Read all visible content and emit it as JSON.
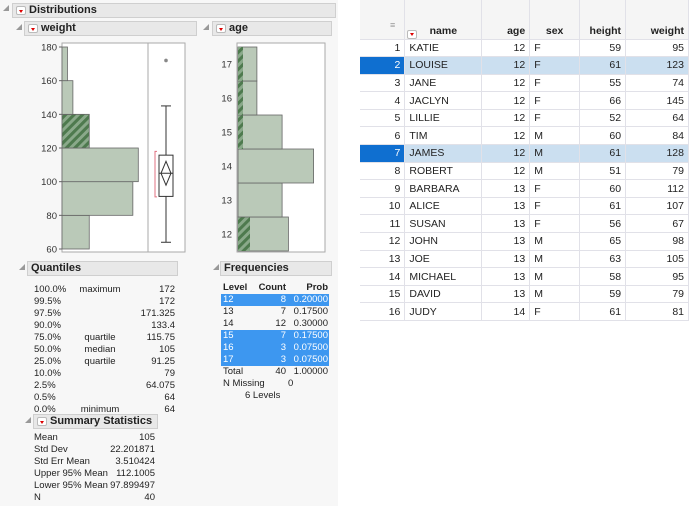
{
  "report": {
    "title": "Distributions"
  },
  "weight": {
    "title": "weight",
    "ticks": [
      60,
      80,
      100,
      120,
      140,
      160,
      180
    ],
    "bins": [
      {
        "lo": 60,
        "hi": 80,
        "count": 5
      },
      {
        "lo": 80,
        "hi": 100,
        "count": 13
      },
      {
        "lo": 100,
        "hi": 120,
        "count": 14
      },
      {
        "lo": 120,
        "hi": 140,
        "count": 5,
        "selected": 5
      },
      {
        "lo": 140,
        "hi": 160,
        "count": 2
      },
      {
        "lo": 160,
        "hi": 180,
        "count": 1
      }
    ],
    "box": {
      "min": 64,
      "q1": 91.25,
      "median": 105,
      "q3": 115.75,
      "whisker_high": 145,
      "outlier": 172,
      "mean": 105,
      "mean_lo": 97.899497,
      "mean_hi": 112.1005,
      "shortest_half": [
        91,
        118
      ]
    },
    "quantiles_title": "Quantiles",
    "quantiles": [
      [
        "100.0%",
        "maximum",
        "172"
      ],
      [
        "99.5%",
        "",
        "172"
      ],
      [
        "97.5%",
        "",
        "171.325"
      ],
      [
        "90.0%",
        "",
        "133.4"
      ],
      [
        "75.0%",
        "quartile",
        "115.75"
      ],
      [
        "50.0%",
        "median",
        "105"
      ],
      [
        "25.0%",
        "quartile",
        "91.25"
      ],
      [
        "10.0%",
        "",
        "79"
      ],
      [
        "2.5%",
        "",
        "64.075"
      ],
      [
        "0.5%",
        "",
        "64"
      ],
      [
        "0.0%",
        "minimum",
        "64"
      ]
    ],
    "summary_title": "Summary Statistics",
    "summary": [
      [
        "Mean",
        "105"
      ],
      [
        "Std Dev",
        "22.201871"
      ],
      [
        "Std Err Mean",
        "3.510424"
      ],
      [
        "Upper 95% Mean",
        "112.1005"
      ],
      [
        "Lower 95% Mean",
        "97.899497"
      ],
      [
        "N",
        "40"
      ]
    ]
  },
  "age": {
    "title": "age",
    "levels": [
      12,
      13,
      14,
      15,
      16,
      17
    ],
    "counts": [
      8,
      7,
      12,
      7,
      3,
      3
    ],
    "selected": [
      2,
      0,
      0,
      1,
      1,
      1
    ],
    "freq_title": "Frequencies",
    "freq_headers": [
      "Level",
      "Count",
      "Prob"
    ],
    "freq": [
      [
        "12",
        "8",
        "0.20000",
        true
      ],
      [
        "13",
        "7",
        "0.17500",
        false
      ],
      [
        "14",
        "12",
        "0.30000",
        false
      ],
      [
        "15",
        "7",
        "0.17500",
        true
      ],
      [
        "16",
        "3",
        "0.07500",
        true
      ],
      [
        "17",
        "3",
        "0.07500",
        true
      ]
    ],
    "total": [
      "Total",
      "40",
      "1.00000"
    ],
    "missing": [
      "N Missing",
      "0"
    ],
    "levels_text": "6  Levels"
  },
  "colors": {
    "bar": "#bac9b8",
    "hatch": "#4e7a4e",
    "selection": "#3d97f0",
    "row_selected": "#cbdff0"
  },
  "table": {
    "columns": [
      "name",
      "age",
      "sex",
      "height",
      "weight"
    ],
    "rows": [
      [
        "1",
        "KATIE",
        "12",
        "F",
        "59",
        "95"
      ],
      [
        "2",
        "LOUISE",
        "12",
        "F",
        "61",
        "123"
      ],
      [
        "3",
        "JANE",
        "12",
        "F",
        "55",
        "74"
      ],
      [
        "4",
        "JACLYN",
        "12",
        "F",
        "66",
        "145"
      ],
      [
        "5",
        "LILLIE",
        "12",
        "F",
        "52",
        "64"
      ],
      [
        "6",
        "TIM",
        "12",
        "M",
        "60",
        "84"
      ],
      [
        "7",
        "JAMES",
        "12",
        "M",
        "61",
        "128"
      ],
      [
        "8",
        "ROBERT",
        "12",
        "M",
        "51",
        "79"
      ],
      [
        "9",
        "BARBARA",
        "13",
        "F",
        "60",
        "112"
      ],
      [
        "10",
        "ALICE",
        "13",
        "F",
        "61",
        "107"
      ],
      [
        "11",
        "SUSAN",
        "13",
        "F",
        "56",
        "67"
      ],
      [
        "12",
        "JOHN",
        "13",
        "M",
        "65",
        "98"
      ],
      [
        "13",
        "JOE",
        "13",
        "M",
        "63",
        "105"
      ],
      [
        "14",
        "MICHAEL",
        "13",
        "M",
        "58",
        "95"
      ],
      [
        "15",
        "DAVID",
        "13",
        "M",
        "59",
        "79"
      ],
      [
        "16",
        "JUDY",
        "14",
        "F",
        "61",
        "81"
      ]
    ],
    "selected_rows": [
      2,
      7
    ]
  }
}
